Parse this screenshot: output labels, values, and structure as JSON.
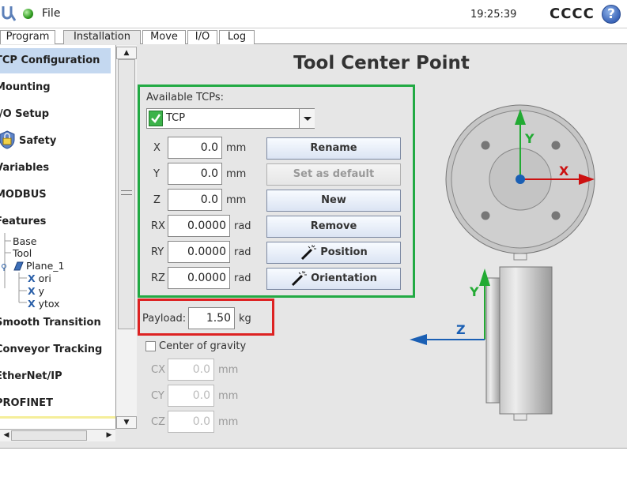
{
  "topbar": {
    "menu_file": "File",
    "clock": "19:25:39",
    "robot_name": "CCCC",
    "help": "?"
  },
  "tabs": [
    {
      "label": "Program"
    },
    {
      "label": "Installation"
    },
    {
      "label": "Move"
    },
    {
      "label": "I/O"
    },
    {
      "label": "Log"
    }
  ],
  "sidebar": {
    "items": [
      {
        "label": "TCP Configuration"
      },
      {
        "label": "Mounting"
      },
      {
        "label": "I/O Setup"
      },
      {
        "label": "Safety"
      },
      {
        "label": "Variables"
      },
      {
        "label": "MODBUS"
      },
      {
        "label": "Features"
      },
      {
        "label": "Smooth Transition"
      },
      {
        "label": "Conveyor Tracking"
      },
      {
        "label": "EtherNet/IP"
      },
      {
        "label": "PROFINET"
      }
    ],
    "features_tree": {
      "base": "Base",
      "tool": "Tool",
      "plane": "Plane_1",
      "plane_children": [
        "ori",
        "y",
        "ytox"
      ]
    }
  },
  "panel": {
    "title": "Tool Center Point",
    "available_label": "Available TCPs:",
    "selected_tcp": "TCP",
    "fields": [
      {
        "label": "X",
        "value": "0.0",
        "unit": "mm"
      },
      {
        "label": "Y",
        "value": "0.0",
        "unit": "mm"
      },
      {
        "label": "Z",
        "value": "0.0",
        "unit": "mm"
      },
      {
        "label": "RX",
        "value": "0.0000",
        "unit": "rad"
      },
      {
        "label": "RY",
        "value": "0.0000",
        "unit": "rad"
      },
      {
        "label": "RZ",
        "value": "0.0000",
        "unit": "rad"
      }
    ],
    "buttons": {
      "rename": "Rename",
      "set_default": "Set as default",
      "new": "New",
      "remove": "Remove",
      "position": "Position",
      "orientation": "Orientation"
    },
    "payload": {
      "label": "Payload:",
      "value": "1.50",
      "unit": "kg"
    },
    "center_of_gravity": {
      "label": "Center of gravity",
      "fields": [
        {
          "label": "CX",
          "value": "0.0",
          "unit": "mm"
        },
        {
          "label": "CY",
          "value": "0.0",
          "unit": "mm"
        },
        {
          "label": "CZ",
          "value": "0.0",
          "unit": "mm"
        }
      ]
    },
    "axis_labels": {
      "x": "X",
      "y_top": "Y",
      "y_side": "Y",
      "z": "Z"
    }
  },
  "colors": {
    "tcp_box": "#22aa44",
    "payload_box": "#dd2222",
    "axis_x": "#cc1111",
    "axis_y": "#22aa33",
    "axis_z": "#1a5fb4"
  }
}
